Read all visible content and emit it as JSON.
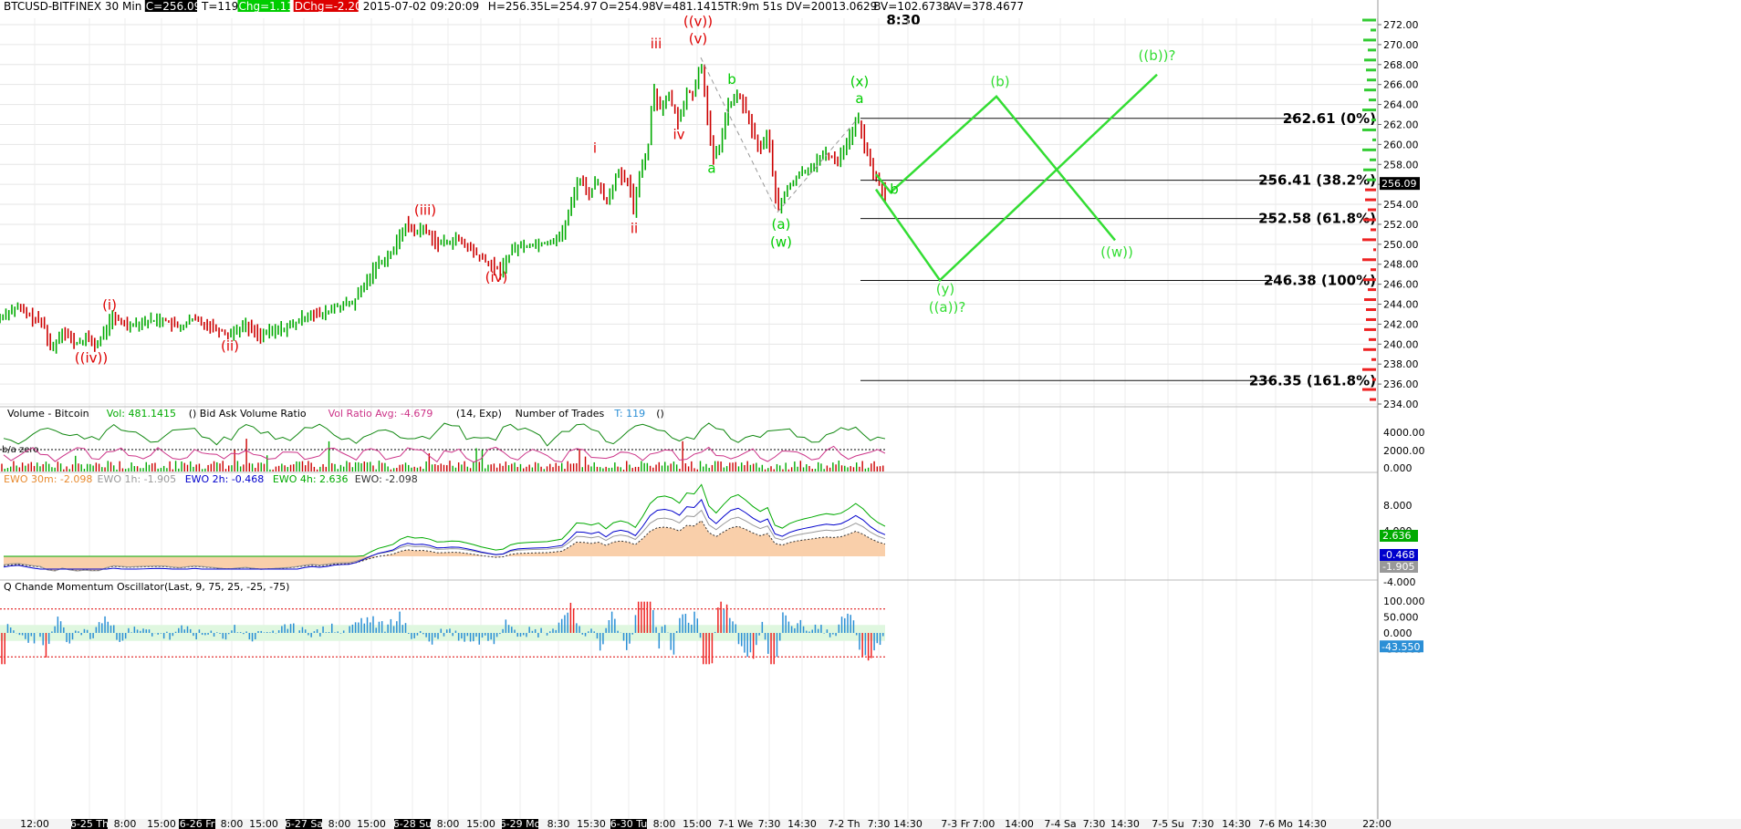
{
  "header": {
    "symbol": "BTCUSD-BITFINEX 30 Min",
    "fields": [
      {
        "text": "C=256.09",
        "style": "black"
      },
      {
        "text": "T=119",
        "style": "plain"
      },
      {
        "text": "Chg=1.11",
        "style": "green"
      },
      {
        "text": "DChg=-2.20",
        "style": "red"
      },
      {
        "text": "2015-07-02 09:20:09",
        "style": "plain"
      },
      {
        "text": "H=256.35",
        "style": "plain"
      },
      {
        "text": "L=254.97",
        "style": "plain"
      },
      {
        "text": "O=254.98",
        "style": "plain"
      },
      {
        "text": "V=481.1415",
        "style": "plain"
      },
      {
        "text": "TR:9m 51s",
        "style": "plain"
      },
      {
        "text": "DV=20013.0629",
        "style": "plain"
      },
      {
        "text": "BV=102.6738",
        "style": "plain"
      },
      {
        "text": "AV=378.4677",
        "style": "plain"
      }
    ],
    "clock": "8:30"
  },
  "colors": {
    "green": "#00cc00",
    "red": "#dd0000",
    "bright_green": "#33dd33",
    "blue": "#0000cc",
    "bar_blue": "#2b8fd6",
    "fill": "#f9cfaa",
    "gray": "#999999"
  },
  "price_axis": {
    "ticks": [
      "272.00",
      "270.00",
      "268.00",
      "266.00",
      "264.00",
      "262.00",
      "260.00",
      "258.00",
      "256.00",
      "254.00",
      "252.00",
      "250.00",
      "248.00",
      "246.00",
      "244.00",
      "242.00",
      "240.00",
      "238.00",
      "236.00",
      "234.00"
    ],
    "current": "256.09"
  },
  "chart_data": {
    "type": "line",
    "title": "BTCUSD-BITFINEX 30 Min",
    "ylim": [
      233,
      273.5
    ],
    "x_start": "2015-06-25",
    "price_path": [
      [
        0,
        242.6
      ],
      [
        8,
        243.3
      ],
      [
        20,
        243.6
      ],
      [
        34,
        242.7
      ],
      [
        48,
        242.0
      ],
      [
        56,
        239.3
      ],
      [
        68,
        241.5
      ],
      [
        82,
        240.0
      ],
      [
        96,
        240.6
      ],
      [
        106,
        239.8
      ],
      [
        122,
        242.6
      ],
      [
        140,
        242.0
      ],
      [
        160,
        242.3
      ],
      [
        178,
        242.5
      ],
      [
        196,
        241.6
      ],
      [
        212,
        242.5
      ],
      [
        230,
        241.9
      ],
      [
        250,
        241.0
      ],
      [
        268,
        241.9
      ],
      [
        286,
        240.9
      ],
      [
        304,
        241.4
      ],
      [
        322,
        241.9
      ],
      [
        340,
        243.2
      ],
      [
        352,
        242.8
      ],
      [
        368,
        243.8
      ],
      [
        386,
        244.0
      ],
      [
        400,
        246.0
      ],
      [
        412,
        247.9
      ],
      [
        430,
        249.2
      ],
      [
        444,
        252.0
      ],
      [
        454,
        251.3
      ],
      [
        466,
        251.5
      ],
      [
        480,
        250.0
      ],
      [
        500,
        250.5
      ],
      [
        516,
        249.5
      ],
      [
        528,
        248.5
      ],
      [
        548,
        247.3
      ],
      [
        562,
        249.6
      ],
      [
        582,
        250.0
      ],
      [
        600,
        250.2
      ],
      [
        616,
        251.0
      ],
      [
        626,
        254.0
      ],
      [
        634,
        256.8
      ],
      [
        646,
        255.0
      ],
      [
        654,
        256.5
      ],
      [
        664,
        254.2
      ],
      [
        676,
        257.0
      ],
      [
        690,
        256.0
      ],
      [
        694,
        253.2
      ],
      [
        700,
        257.0
      ],
      [
        710,
        259.5
      ],
      [
        716,
        266.0
      ],
      [
        722,
        263.5
      ],
      [
        732,
        265.0
      ],
      [
        744,
        262.0
      ],
      [
        752,
        265.5
      ],
      [
        760,
        264.8
      ],
      [
        768,
        268.7
      ],
      [
        776,
        262.0
      ],
      [
        781,
        258.4
      ],
      [
        789,
        260.0
      ],
      [
        797,
        263.7
      ],
      [
        810,
        265.0
      ],
      [
        822,
        262.0
      ],
      [
        832,
        259.5
      ],
      [
        842,
        261.0
      ],
      [
        852,
        253.2
      ],
      [
        862,
        255.5
      ],
      [
        876,
        257.0
      ],
      [
        890,
        257.9
      ],
      [
        904,
        259.0
      ],
      [
        918,
        258.5
      ],
      [
        930,
        260.5
      ],
      [
        940,
        262.6
      ],
      [
        950,
        259.0
      ],
      [
        960,
        256.5
      ],
      [
        970,
        255.0
      ]
    ],
    "ohlc_bars": {
      "count": 300,
      "x_range": [
        0,
        970
      ],
      "up_color": "#00aa00",
      "down_color": "#cc0000"
    },
    "fib_levels": [
      {
        "label": "262.61  (0%)",
        "value": 262.61
      },
      {
        "label": "256.41  (38.2%)",
        "value": 256.41
      },
      {
        "label": "252.58  (61.8%)",
        "value": 252.58
      },
      {
        "label": "246.38  (100%)",
        "value": 246.38
      },
      {
        "label": "236.35  (161.8%)",
        "value": 236.35
      }
    ],
    "projection_paths": [
      [
        [
          960,
          257.0
        ],
        [
          976,
          255.2
        ],
        [
          1092,
          264.8
        ],
        [
          1222,
          250.4
        ]
      ],
      [
        [
          960,
          255.5
        ],
        [
          1030,
          246.4
        ],
        [
          1268,
          267.0
        ]
      ]
    ],
    "wave_labels": [
      {
        "text": "((iv))",
        "x": 100,
        "y": 238.6,
        "color": "red"
      },
      {
        "text": "(i)",
        "x": 120,
        "y": 243.9,
        "color": "red"
      },
      {
        "text": "(ii)",
        "x": 252,
        "y": 239.8,
        "color": "red"
      },
      {
        "text": "(iii)",
        "x": 466,
        "y": 253.4,
        "color": "red"
      },
      {
        "text": "(iv)",
        "x": 544,
        "y": 246.7,
        "color": "red"
      },
      {
        "text": "i",
        "x": 652,
        "y": 259.6,
        "color": "red"
      },
      {
        "text": "ii",
        "x": 695,
        "y": 251.6,
        "color": "red"
      },
      {
        "text": "iii",
        "x": 719,
        "y": 270.1,
        "color": "red"
      },
      {
        "text": "iv",
        "x": 744,
        "y": 261.0,
        "color": "red"
      },
      {
        "text": "((v))",
        "x": 765,
        "y": 272.3,
        "color": "red"
      },
      {
        "text": "(v)",
        "x": 765,
        "y": 270.6,
        "color": "red"
      },
      {
        "text": "b",
        "x": 802,
        "y": 266.5,
        "color": "green"
      },
      {
        "text": "a",
        "x": 780,
        "y": 257.6,
        "color": "green"
      },
      {
        "text": "(a)",
        "x": 856,
        "y": 252.0,
        "color": "green"
      },
      {
        "text": "(w)",
        "x": 856,
        "y": 250.2,
        "color": "green"
      },
      {
        "text": "(x)",
        "x": 942,
        "y": 266.3,
        "color": "green"
      },
      {
        "text": "a",
        "x": 942,
        "y": 264.6,
        "color": "green"
      },
      {
        "text": "b",
        "x": 980,
        "y": 255.5,
        "color": "green"
      },
      {
        "text": "(b)",
        "x": 1096,
        "y": 266.3,
        "color": "bright_green"
      },
      {
        "text": "((b))?",
        "x": 1268,
        "y": 268.9,
        "color": "bright_green"
      },
      {
        "text": "((w))",
        "x": 1224,
        "y": 249.2,
        "color": "bright_green"
      },
      {
        "text": "(y)",
        "x": 1036,
        "y": 245.5,
        "color": "bright_green"
      },
      {
        "text": "((a))?",
        "x": 1038,
        "y": 243.7,
        "color": "bright_green"
      }
    ],
    "x_ticks": [
      "12:00",
      "6-25 Th",
      "8:00",
      "15:00",
      "6-26 Fr",
      "8:00",
      "15:00",
      "6-27 Sa",
      "8:00",
      "15:00",
      "6-28 Su",
      "8:00",
      "15:00",
      "6-29 Mo",
      "8:30",
      "15:30",
      "6-30 Tu",
      "8:00",
      "15:00",
      "7-1 We",
      "7:30",
      "14:30",
      "7-2 Th",
      "7:30",
      "14:30",
      "7-3 Fr",
      "7:00",
      "14:00",
      "7-4 Sa",
      "7:30",
      "14:30",
      "7-5 Su",
      "7:30",
      "14:30",
      "7-6 Mo",
      "14:30",
      "22:00"
    ],
    "x_tick_pos": [
      38,
      98,
      137,
      177,
      216,
      254,
      289,
      333,
      372,
      407,
      452,
      491,
      527,
      570,
      612,
      648,
      689,
      728,
      764,
      806,
      843,
      879,
      925,
      963,
      995,
      1047,
      1078,
      1117,
      1162,
      1199,
      1233,
      1280,
      1318,
      1355,
      1398,
      1438,
      1509
    ],
    "volume_panel": {
      "title": "Volume - Bitcoin",
      "vol_text": "Vol: 481.1415",
      "ratio_title": "() Bid Ask Volume Ratio",
      "ratio_avg": "Vol Ratio Avg: -4.679",
      "params": "(14, Exp)",
      "trades_title": "Number of Trades",
      "trades_value": "T: 119",
      "trades_params": "()",
      "zero_label": "b/a zero",
      "ticks": [
        "4000.00",
        "2000.00",
        "0.000"
      ]
    },
    "ewo_panel": {
      "labels": [
        {
          "text": "EWO 30m: -2.098",
          "color": "#e88a2e"
        },
        {
          "text": "EWO 1h: -1.905",
          "color": "#999999"
        },
        {
          "text": "EWO 2h: -0.468",
          "color": "#0000cc"
        },
        {
          "text": "EWO 4h: 2.636",
          "color": "#00aa00"
        },
        {
          "text": "EWO: -2.098",
          "color": "#333333"
        }
      ],
      "ticks": [
        "8.000",
        "4.000",
        "0.000",
        "-4.000"
      ],
      "badges": [
        {
          "text": "2.636",
          "color": "#00aa00"
        },
        {
          "text": "-0.468",
          "color": "#0000cc"
        },
        {
          "text": "-1.905",
          "color": "#999999"
        }
      ]
    },
    "cmo_panel": {
      "title": "Q Chande Momentum Oscillator",
      "params": "(Last, 9, 75, 25, -25, -75)",
      "ticks": [
        "100.000",
        "50.000",
        "0.000",
        "-50.000"
      ],
      "current": "-43.550"
    }
  }
}
